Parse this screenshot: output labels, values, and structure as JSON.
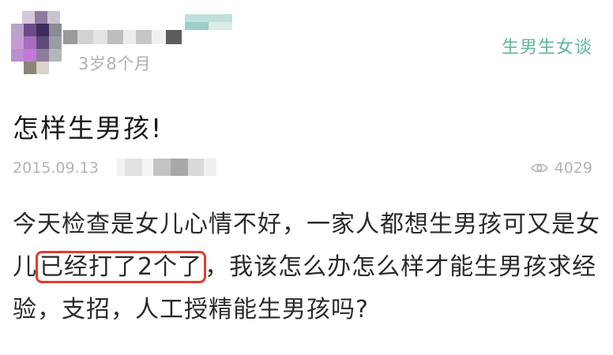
{
  "post_header": {
    "child_age": "3岁8个月",
    "category": "生男生女谈"
  },
  "post": {
    "title": "怎样生男孩!",
    "date": "2015.09.13",
    "views": "4029",
    "body_before": "今天检查是女儿心情不好，一家人都想生男孩可又是女儿",
    "body_highlight": "已经打了2个了",
    "body_after": "，我该怎么办怎么样才能生男孩求经验，支招，人工授精能生男孩吗?"
  },
  "colors": {
    "category": "#5fb89a",
    "highlight_border": "#e53a30",
    "muted_text": "#b4b4b4"
  },
  "icons": {
    "views": "eye-icon"
  }
}
